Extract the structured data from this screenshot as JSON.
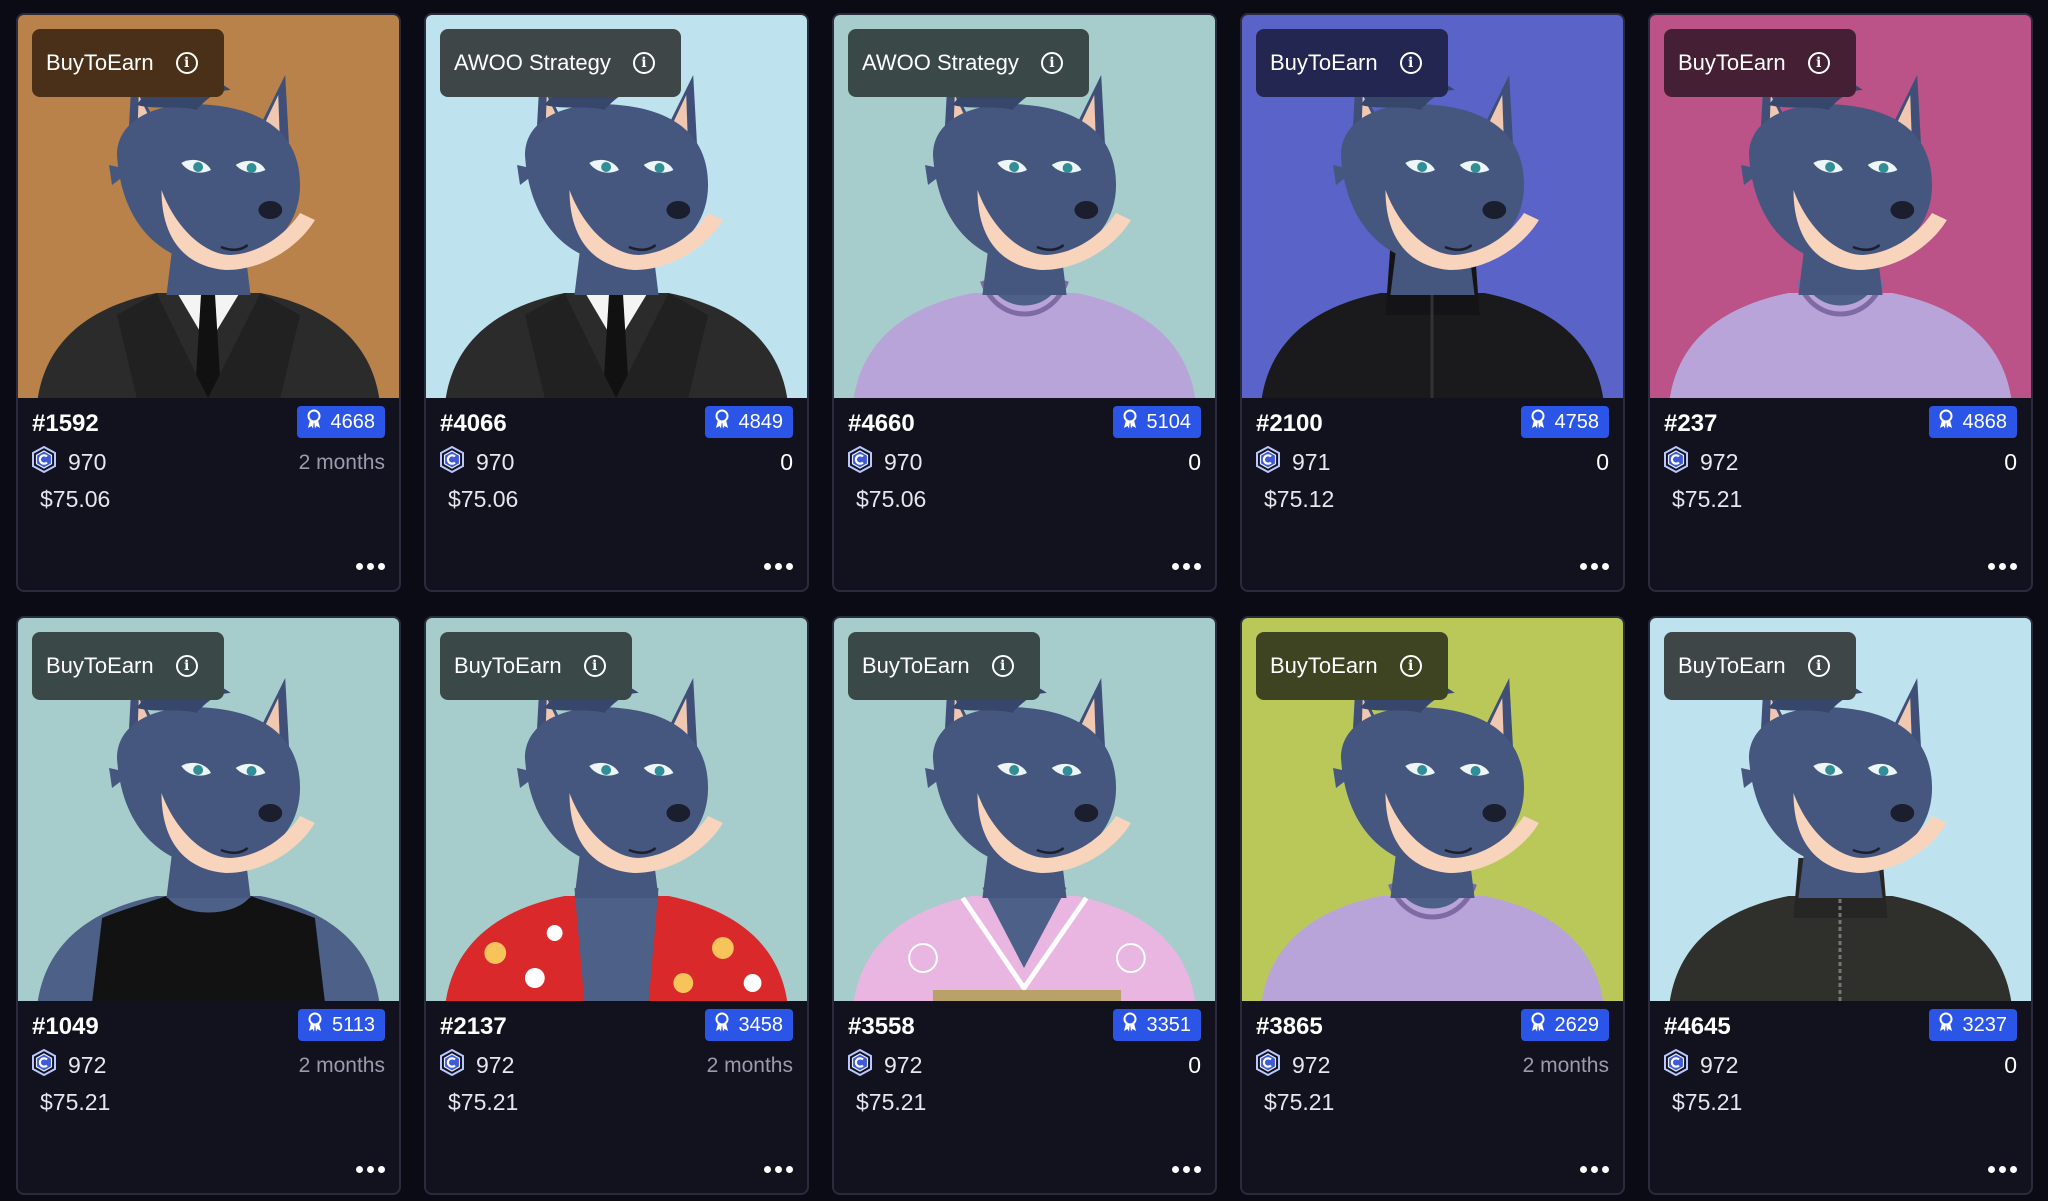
{
  "cards": [
    {
      "strategy": "BuyToEarn",
      "id": "#1592",
      "rank": "4668",
      "price": "970",
      "time": "2 months",
      "usd": "$75.06",
      "bg": "#b9824a",
      "badge_bg": "#4a3018",
      "outfit": "suit"
    },
    {
      "strategy": "AWOO Strategy",
      "id": "#4066",
      "rank": "4849",
      "price": "970",
      "time": "0",
      "usd": "$75.06",
      "bg": "#bfe3ee",
      "badge_bg": "#3e4648",
      "outfit": "suit"
    },
    {
      "strategy": "AWOO Strategy",
      "id": "#4660",
      "rank": "5104",
      "price": "970",
      "time": "0",
      "usd": "$75.06",
      "bg": "#a6cdcb",
      "badge_bg": "#3a4848",
      "outfit": "tshirt"
    },
    {
      "strategy": "BuyToEarn",
      "id": "#2100",
      "rank": "4758",
      "price": "971",
      "time": "0",
      "usd": "$75.12",
      "bg": "#5a63c8",
      "badge_bg": "#222650",
      "outfit": "jacket"
    },
    {
      "strategy": "BuyToEarn",
      "id": "#237",
      "rank": "4868",
      "price": "972",
      "time": "0",
      "usd": "$75.21",
      "bg": "#bb5288",
      "badge_bg": "#452034",
      "outfit": "tshirt"
    },
    {
      "strategy": "BuyToEarn",
      "id": "#1049",
      "rank": "5113",
      "price": "972",
      "time": "2 months",
      "usd": "$75.21",
      "bg": "#a6cdcb",
      "badge_bg": "#3a4848",
      "outfit": "tank"
    },
    {
      "strategy": "BuyToEarn",
      "id": "#2137",
      "rank": "3458",
      "price": "972",
      "time": "2 months",
      "usd": "$75.21",
      "bg": "#a6cdcb",
      "badge_bg": "#3a4848",
      "outfit": "hawaii"
    },
    {
      "strategy": "BuyToEarn",
      "id": "#3558",
      "rank": "3351",
      "price": "972",
      "time": "0",
      "usd": "$75.21",
      "bg": "#a6cdcb",
      "badge_bg": "#3a4848",
      "outfit": "kimono"
    },
    {
      "strategy": "BuyToEarn",
      "id": "#3865",
      "rank": "2629",
      "price": "972",
      "time": "2 months",
      "usd": "$75.21",
      "bg": "#bac85a",
      "badge_bg": "#3e4322",
      "outfit": "tshirt"
    },
    {
      "strategy": "BuyToEarn",
      "id": "#4645",
      "rank": "3237",
      "price": "972",
      "time": "0",
      "usd": "$75.21",
      "bg": "#bfe3ee",
      "badge_bg": "#3e4648",
      "outfit": "leather"
    }
  ],
  "icons": {
    "info": "info-icon",
    "rank": "ribbon-icon",
    "price": "coin-icon",
    "more": "more-dots-icon"
  },
  "colors": {
    "page_bg": "#0a0b14",
    "card_bg": "#11121d",
    "rank_badge": "#2b55e6",
    "muted_text": "#9a9bad"
  }
}
